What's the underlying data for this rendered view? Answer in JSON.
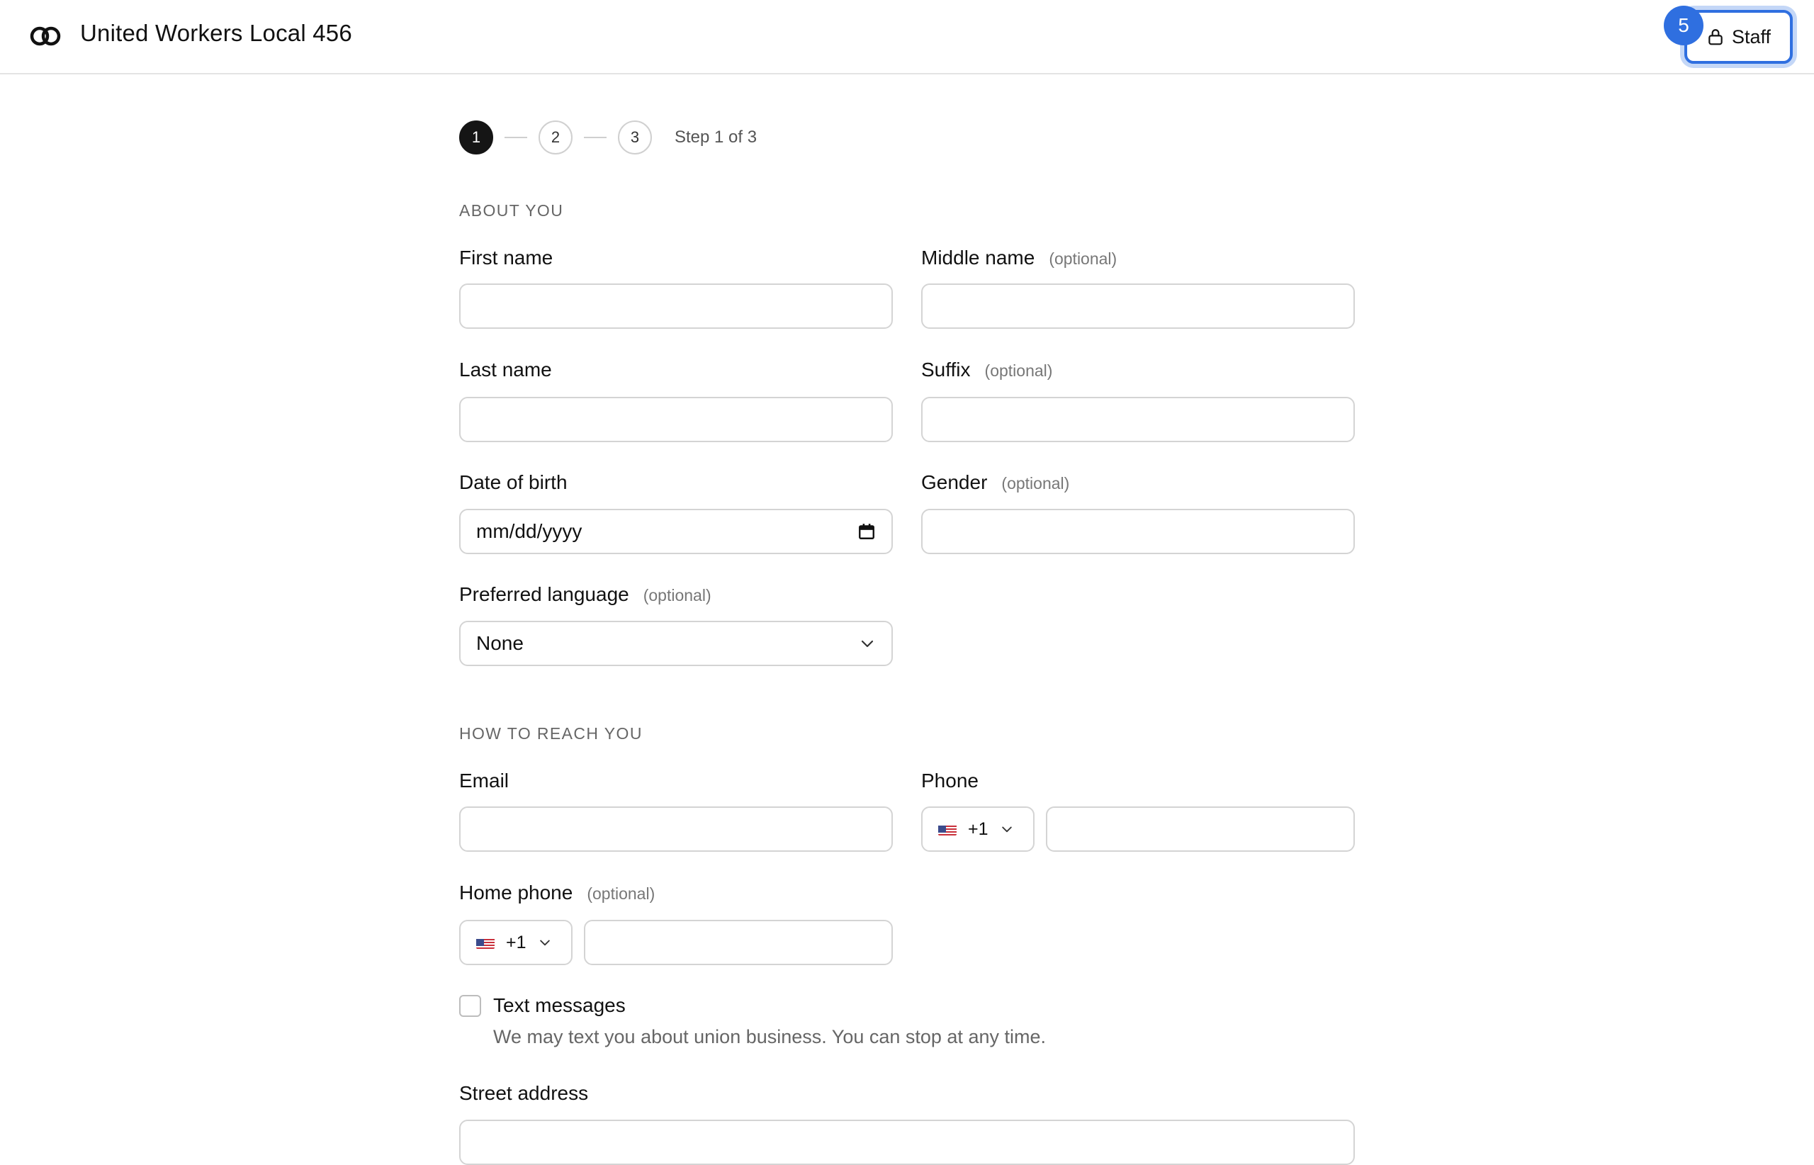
{
  "header": {
    "org_name": "United Workers Local 456",
    "staff_label": "Staff",
    "badge_count": "5"
  },
  "stepper": {
    "steps": [
      "1",
      "2",
      "3"
    ],
    "active_step": 1,
    "status": "Step 1 of 3"
  },
  "about": {
    "section_title": "ABOUT YOU",
    "first_name_label": "First name",
    "middle_name_label": "Middle name",
    "last_name_label": "Last name",
    "suffix_label": "Suffix",
    "dob_label": "Date of birth",
    "dob_placeholder": "mm/dd/yyyy",
    "gender_label": "Gender",
    "language_label": "Preferred language",
    "language_value": "None",
    "optional_text": "(optional)"
  },
  "contact": {
    "section_title": "HOW TO REACH YOU",
    "email_label": "Email",
    "phone_label": "Phone",
    "phone_country_code": "+1",
    "home_phone_label": "Home phone",
    "home_phone_country_code": "+1",
    "text_messages_label": "Text messages",
    "text_messages_help": "We may text you about union business. You can stop at any time.",
    "street_address_label": "Street address"
  },
  "colors": {
    "accent": "#2f6fe0",
    "active_step": "#151515",
    "border": "#d4d4d4"
  },
  "icons": {
    "logo": "interlocking-rings-icon",
    "staff": "lock-icon",
    "date": "calendar-icon",
    "select": "chevron-down-icon",
    "flag": "us-flag-icon"
  }
}
